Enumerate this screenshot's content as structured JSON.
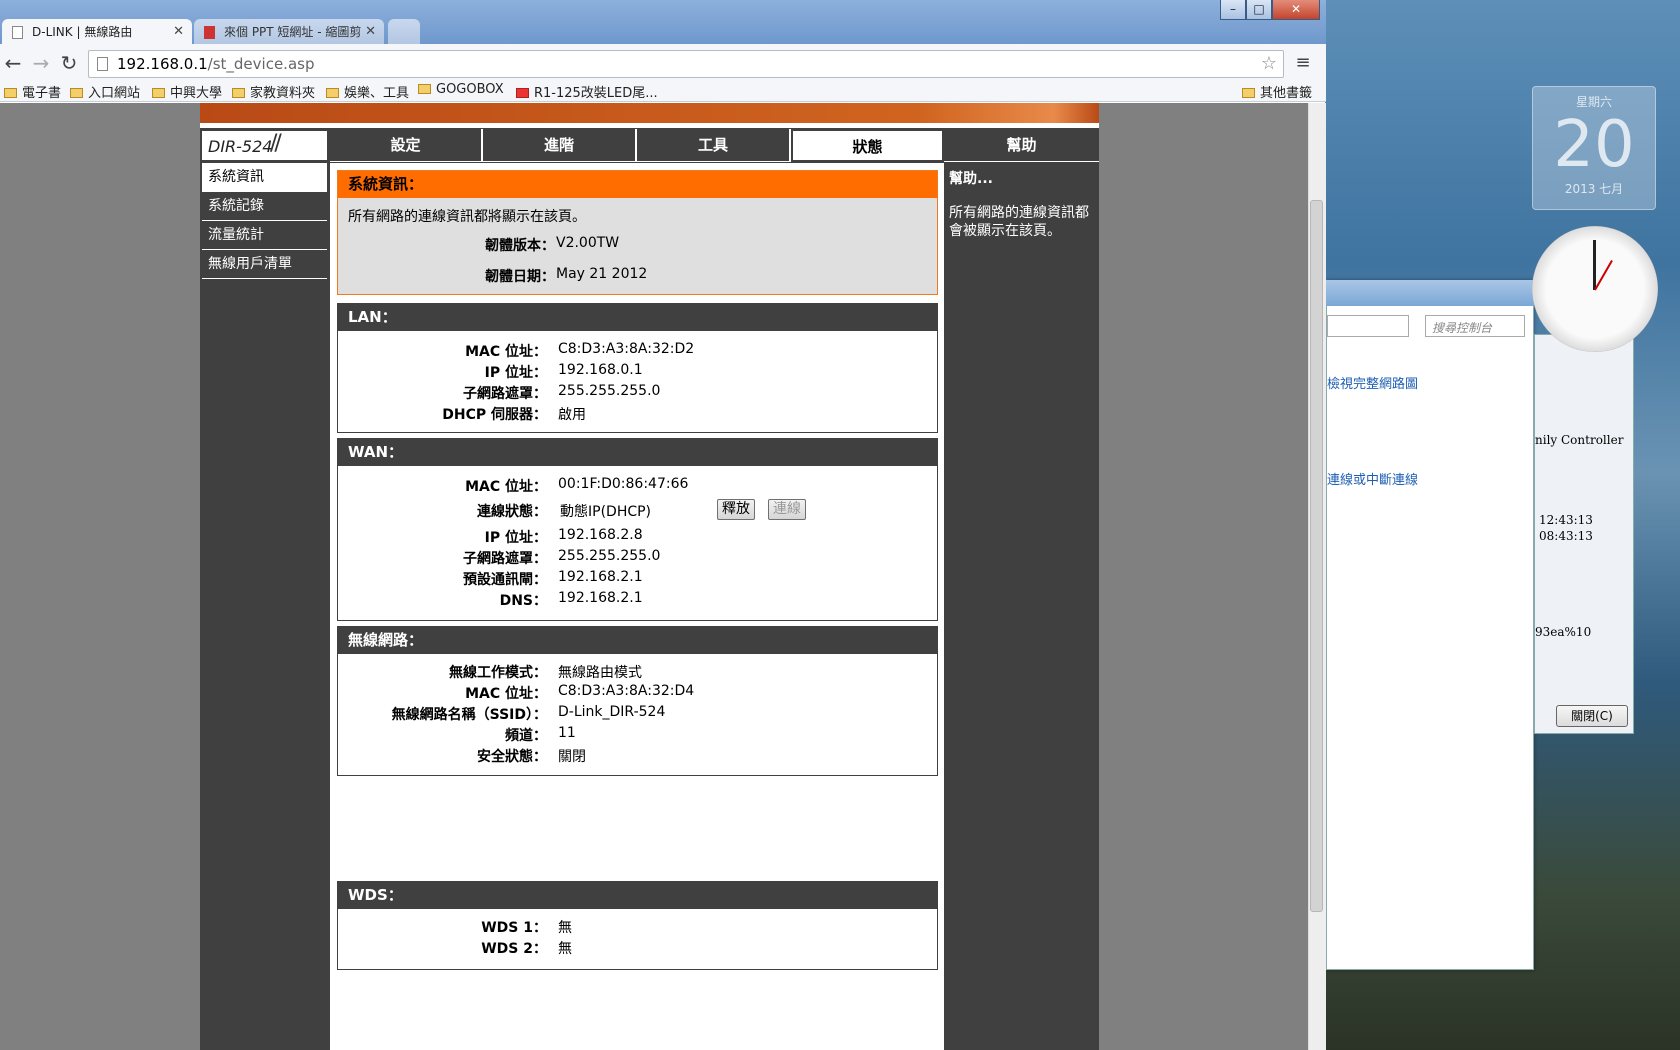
{
  "browser": {
    "tabs": [
      {
        "label": "D-LINK | 無線路由",
        "active": true
      },
      {
        "label": "來個 PPT 短網址 - 縮圖剪",
        "active": false
      }
    ],
    "address_host": "192.168.0.1",
    "address_path": "/st_device.asp",
    "bookmarks": [
      "電子書",
      "入口網站",
      "中興大學",
      "家教資料夾",
      "娛樂、工具",
      "GOGOBOX",
      "R1-125改裝LED尾...",
      "其他書籤"
    ]
  },
  "router": {
    "model": "DIR-524",
    "nav": [
      "設定",
      "進階",
      "工具",
      "狀態",
      "幫助"
    ],
    "sidebar": [
      "系統資訊",
      "系統記錄",
      "流量統計",
      "無線用戶清單"
    ],
    "info": {
      "title": "系統資訊：",
      "desc": "所有網路的連線資訊都將顯示在該頁。",
      "firmware_version_label": "韌體版本：",
      "firmware_version": "V2.00TW",
      "firmware_date_label": "韌體日期：",
      "firmware_date": "May 21 2012"
    },
    "lan": {
      "title": "LAN：",
      "rows": [
        {
          "label": "MAC 位址：",
          "value": "C8:D3:A3:8A:32:D2"
        },
        {
          "label": "IP 位址：",
          "value": "192.168.0.1"
        },
        {
          "label": "子網路遮罩：",
          "value": "255.255.255.0"
        },
        {
          "label": "DHCP 伺服器：",
          "value": "啟用"
        }
      ]
    },
    "wan": {
      "title": "WAN：",
      "rows": [
        {
          "label": "MAC 位址：",
          "value": "00:1F:D0:86:47:66"
        },
        {
          "label": "連線狀態：",
          "value": "動態IP(DHCP)"
        },
        {
          "label": "IP 位址：",
          "value": "192.168.2.8"
        },
        {
          "label": "子網路遮罩：",
          "value": "255.255.255.0"
        },
        {
          "label": "預設通訊閘：",
          "value": "192.168.2.1"
        },
        {
          "label": "DNS：",
          "value": "192.168.2.1"
        }
      ],
      "release_button": "釋放",
      "connect_button": "連線"
    },
    "wireless": {
      "title": "無線網路：",
      "rows": [
        {
          "label": "無線工作模式：",
          "value": "無線路由模式"
        },
        {
          "label": "MAC 位址：",
          "value": "C8:D3:A3:8A:32:D4"
        },
        {
          "label": "無線網路名稱（SSID）：",
          "value": "D-Link_DIR-524"
        },
        {
          "label": "頻道：",
          "value": "11"
        },
        {
          "label": "安全狀態：",
          "value": "關閉"
        }
      ]
    },
    "wds": {
      "title": "WDS：",
      "rows": [
        {
          "label": "WDS 1：",
          "value": "無"
        },
        {
          "label": "WDS 2：",
          "value": "無"
        }
      ]
    },
    "help": {
      "title": "幫助...",
      "text": "所有網路的連線資訊都會被顯示在該頁。"
    }
  },
  "desktop": {
    "calendar_dow": "星期六",
    "calendar_day": "20",
    "calendar_ym": "2013 七月",
    "bg_search_placeholder": "搜尋控制台",
    "bg_links": [
      "檢視完整網路圖",
      "連線或中斷連線"
    ],
    "bg_texts": [
      "nily Controller",
      "12:43:13",
      "08:43:13",
      "93ea%10"
    ],
    "bg_close_button": "關閉(C)"
  }
}
